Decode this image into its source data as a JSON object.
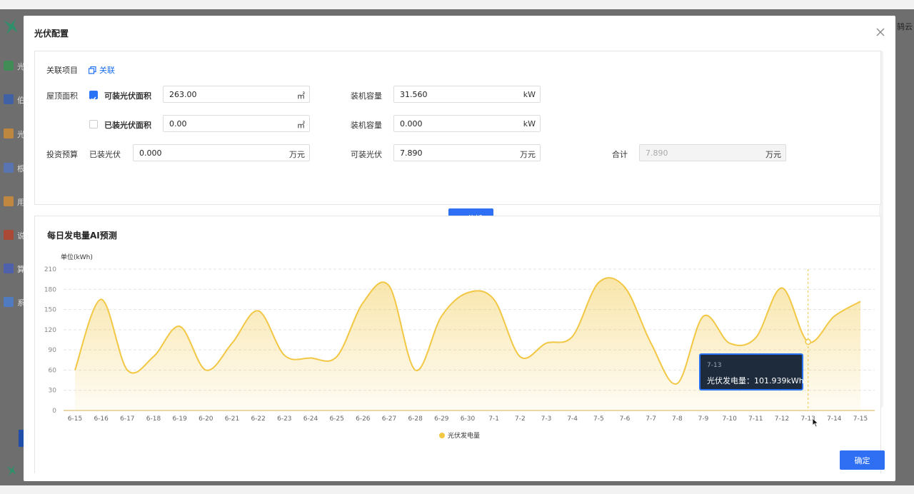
{
  "background": {
    "side_labels": [
      "光",
      "伯",
      "光",
      "根",
      "用",
      "说",
      "算",
      "系"
    ],
    "right_text": "鸫云"
  },
  "modal": {
    "title": "光伏配置",
    "close_icon": "close-icon",
    "confirm_label": "确定"
  },
  "config": {
    "project_label": "关联项目",
    "project_link": "关联",
    "roof_label": "屋顶面积",
    "installable_area_label": "可装光伏面积",
    "installable_area_value": "263.00",
    "area_unit": "㎡",
    "installed_area_label": "已装光伏面积",
    "installed_area_value": "0.00",
    "capacity_label": "装机容量",
    "capacity1_value": "31.560",
    "capacity2_value": "0.000",
    "capacity_unit": "kW",
    "budget_label": "投资预算",
    "installed_pv_label": "已装光伏",
    "installed_pv_value": "0.000",
    "installable_pv_label": "可装光伏",
    "installable_pv_value": "7.890",
    "total_label": "合计",
    "total_value": "7.890",
    "money_unit": "万元",
    "ai_button": "AI分析",
    "installable_checked": true,
    "installed_checked": false
  },
  "chart_section": {
    "title": "每日发电量AI预测",
    "tooltip_date": "7-13",
    "tooltip_text": "光伏发电量：101.939kWh"
  },
  "chart_data": {
    "type": "area",
    "title": "每日发电量AI预测",
    "ylabel": "单位(kWh)",
    "ylim": [
      0,
      210
    ],
    "yticks": [
      0,
      30,
      60,
      90,
      120,
      150,
      180,
      210
    ],
    "grid": true,
    "legend": "bottom-center",
    "color": "#f2c744",
    "categories": [
      "6-15",
      "6-16",
      "6-17",
      "6-18",
      "6-19",
      "6-20",
      "6-21",
      "6-22",
      "6-23",
      "6-24",
      "6-25",
      "6-26",
      "6-27",
      "6-28",
      "6-29",
      "6-30",
      "7-1",
      "7-2",
      "7-3",
      "7-4",
      "7-5",
      "7-6",
      "7-7",
      "7-8",
      "7-9",
      "7-10",
      "7-11",
      "7-12",
      "7-13",
      "7-14",
      "7-15"
    ],
    "series": [
      {
        "name": "光伏发电量",
        "values": [
          60,
          165,
          60,
          80,
          125,
          60,
          100,
          148,
          82,
          78,
          80,
          160,
          185,
          60,
          140,
          175,
          165,
          80,
          100,
          110,
          190,
          183,
          100,
          40,
          140,
          100,
          108,
          182,
          101.939,
          140,
          162
        ]
      }
    ],
    "highlight_category": "7-13"
  }
}
